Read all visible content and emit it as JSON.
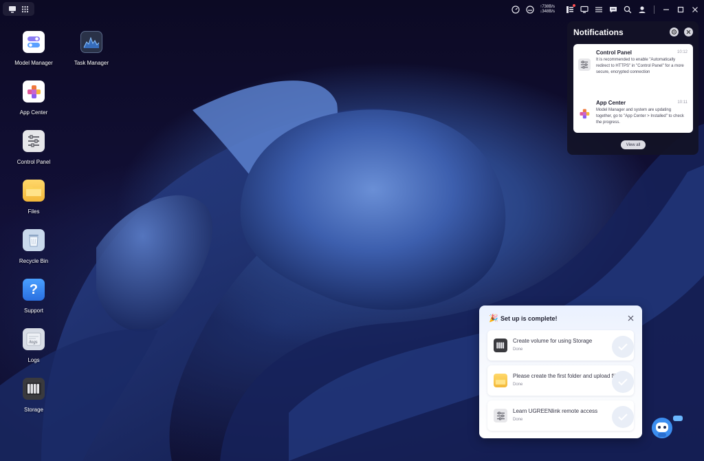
{
  "topbar": {
    "upload_speed": "↑738B/s",
    "download_speed": "↓348B/s"
  },
  "desktop": {
    "icons": [
      {
        "label": "Model Manager",
        "icon": "model-manager-icon"
      },
      {
        "label": "Task Manager",
        "icon": "task-manager-icon"
      },
      {
        "label": "App Center",
        "icon": "app-center-icon"
      },
      {
        "label": "Control Panel",
        "icon": "control-panel-icon"
      },
      {
        "label": "Files",
        "icon": "files-icon"
      },
      {
        "label": "Recycle Bin",
        "icon": "recycle-bin-icon"
      },
      {
        "label": "Support",
        "icon": "support-icon"
      },
      {
        "label": "Logs",
        "icon": "logs-icon"
      },
      {
        "label": "Storage",
        "icon": "storage-icon"
      }
    ]
  },
  "notifications": {
    "title": "Notifications",
    "items": [
      {
        "title": "Control Panel",
        "time": "10:12",
        "body": "It is recommended to enable \"Automatically redirect to HTTPS\" in \"Control Panel\" for a more secure, encrypted connection",
        "icon": "control-panel-icon"
      },
      {
        "title": "App Center",
        "time": "10:11",
        "body": "Model Manager and system are updating together, go to \"App Center > Installed\" to check the progress.",
        "icon": "app-center-icon"
      }
    ],
    "view_all": "View all"
  },
  "setup": {
    "title": "Set up is complete!",
    "tasks": [
      {
        "label": "Create volume for using Storage",
        "status": "Done",
        "icon": "storage-icon"
      },
      {
        "label": "Please create the first folder and upload files!",
        "status": "Done",
        "icon": "folder-icon"
      },
      {
        "label": "Learn UGREENlink remote access",
        "status": "Done",
        "icon": "control-panel-icon"
      }
    ]
  },
  "colors": {
    "accent": "#3c5ea8",
    "notification_bg": "#121226",
    "red_dot": "#ff4d4f"
  }
}
